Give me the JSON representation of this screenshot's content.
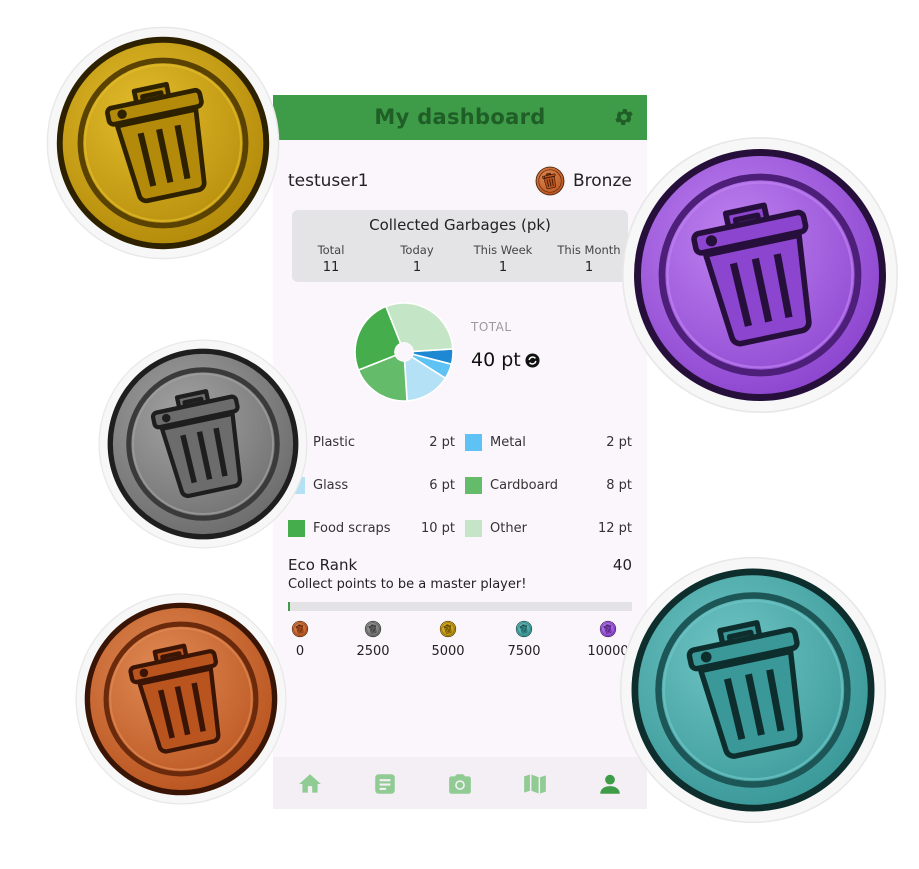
{
  "header": {
    "title": "My dashboard"
  },
  "user": {
    "name": "testuser1",
    "rank": "Bronze"
  },
  "collected": {
    "title": "Collected Garbages (pk)",
    "stats": [
      {
        "label": "Total",
        "value": "11"
      },
      {
        "label": "Today",
        "value": "1"
      },
      {
        "label": "This Week",
        "value": "1"
      },
      {
        "label": "This Month",
        "value": "1"
      }
    ]
  },
  "total": {
    "label": "TOTAL",
    "value": "40 pt"
  },
  "legend": [
    {
      "name": "Plastic",
      "pts": "2 pt",
      "color": "#1e88d2"
    },
    {
      "name": "Metal",
      "pts": "2 pt",
      "color": "#5ec3f4"
    },
    {
      "name": "Glass",
      "pts": "6 pt",
      "color": "#b5e1f7"
    },
    {
      "name": "Cardboard",
      "pts": "8 pt",
      "color": "#64bb6a"
    },
    {
      "name": "Food scraps",
      "pts": "10 pt",
      "color": "#45ad4c"
    },
    {
      "name": "Other",
      "pts": "12 pt",
      "color": "#c5e6c6"
    }
  ],
  "chart_data": {
    "type": "pie",
    "categories": [
      "Plastic",
      "Metal",
      "Glass",
      "Cardboard",
      "Food scraps",
      "Other"
    ],
    "values": [
      2,
      2,
      6,
      8,
      10,
      12
    ]
  },
  "eco": {
    "title": "Eco Rank",
    "value": "40",
    "subtitle": "Collect points to be a master player!",
    "progress_fraction": 0.004,
    "tiers": [
      {
        "value": "0",
        "medal": "bronze"
      },
      {
        "value": "2500",
        "medal": "silver"
      },
      {
        "value": "5000",
        "medal": "gold"
      },
      {
        "value": "7500",
        "medal": "teal"
      },
      {
        "value": "10000",
        "medal": "purple"
      }
    ]
  },
  "nav": [
    {
      "icon": "home-icon"
    },
    {
      "icon": "document-icon"
    },
    {
      "icon": "camera-icon"
    },
    {
      "icon": "map-icon"
    },
    {
      "icon": "person-icon",
      "active": true
    }
  ],
  "colors": {
    "header": "#3e9b47",
    "bronze": "#c8642f",
    "silver": "#7d7d7d",
    "gold": "#c69b12",
    "teal": "#3fa3a3",
    "purple": "#9b52d8"
  }
}
